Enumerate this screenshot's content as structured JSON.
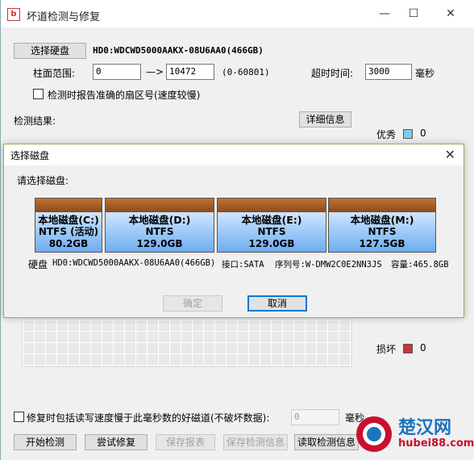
{
  "window": {
    "title": "坏道检测与修复",
    "icon_char": "b",
    "minimize": "—",
    "maximize": "☐",
    "close": "✕"
  },
  "disk_select": {
    "button": "选择硬盘",
    "disk_info": "HD0:WDCWD5000AAKX-08U6AA0(466GB)"
  },
  "range": {
    "label": "柱面范围:",
    "from_value": "0",
    "arrow": "—>",
    "to_value": "10472",
    "hint": "(0-60801)",
    "timeout_label": "超时时间:",
    "timeout_value": "3000",
    "timeout_unit": "毫秒"
  },
  "report_sector_checkbox": "检测时报告准确的扇区号(速度较慢)",
  "results": {
    "label": "检测结果:",
    "detail_button": "详细信息"
  },
  "legend": {
    "excellent": {
      "label": "优秀",
      "count": "0",
      "color": "#7ecbee"
    },
    "damaged": {
      "label": "损坏",
      "count": "0",
      "color": "#c8333f"
    }
  },
  "repair": {
    "checkbox_label": "修复时包括读写速度慢于此毫秒数的好磁道(不破坏数据):",
    "ms_value": "0",
    "ms_unit": "毫秒"
  },
  "bottom_buttons": {
    "start": "开始检测",
    "try_repair": "尝试修复",
    "save_report": "保存报表",
    "save_result": "保存检测信息",
    "read_result": "读取检测信息"
  },
  "modal": {
    "title": "选择磁盘",
    "close": "✕",
    "prompt": "请选择磁盘:",
    "disks": [
      {
        "name": "本地磁盘(C:)",
        "fs": "NTFS (活动)",
        "size": "80.2GB"
      },
      {
        "name": "本地磁盘(D:)",
        "fs": "NTFS",
        "size": "129.0GB"
      },
      {
        "name": "本地磁盘(E:)",
        "fs": "NTFS",
        "size": "129.0GB"
      },
      {
        "name": "本地磁盘(M:)",
        "fs": "NTFS",
        "size": "127.5GB"
      }
    ],
    "disk_label": "硬盘",
    "disk_model": "HD0:WDCWD5000AAKX-08U6AA0(466GB)",
    "interface": "接口:SATA",
    "serial": "序列号:W-DMW2C0E2NN3JS",
    "capacity": "容量:465.8GB",
    "ok": "确定",
    "cancel": "取消"
  },
  "watermark": {
    "cn": "楚汉网",
    "en": "hubei88.com"
  }
}
